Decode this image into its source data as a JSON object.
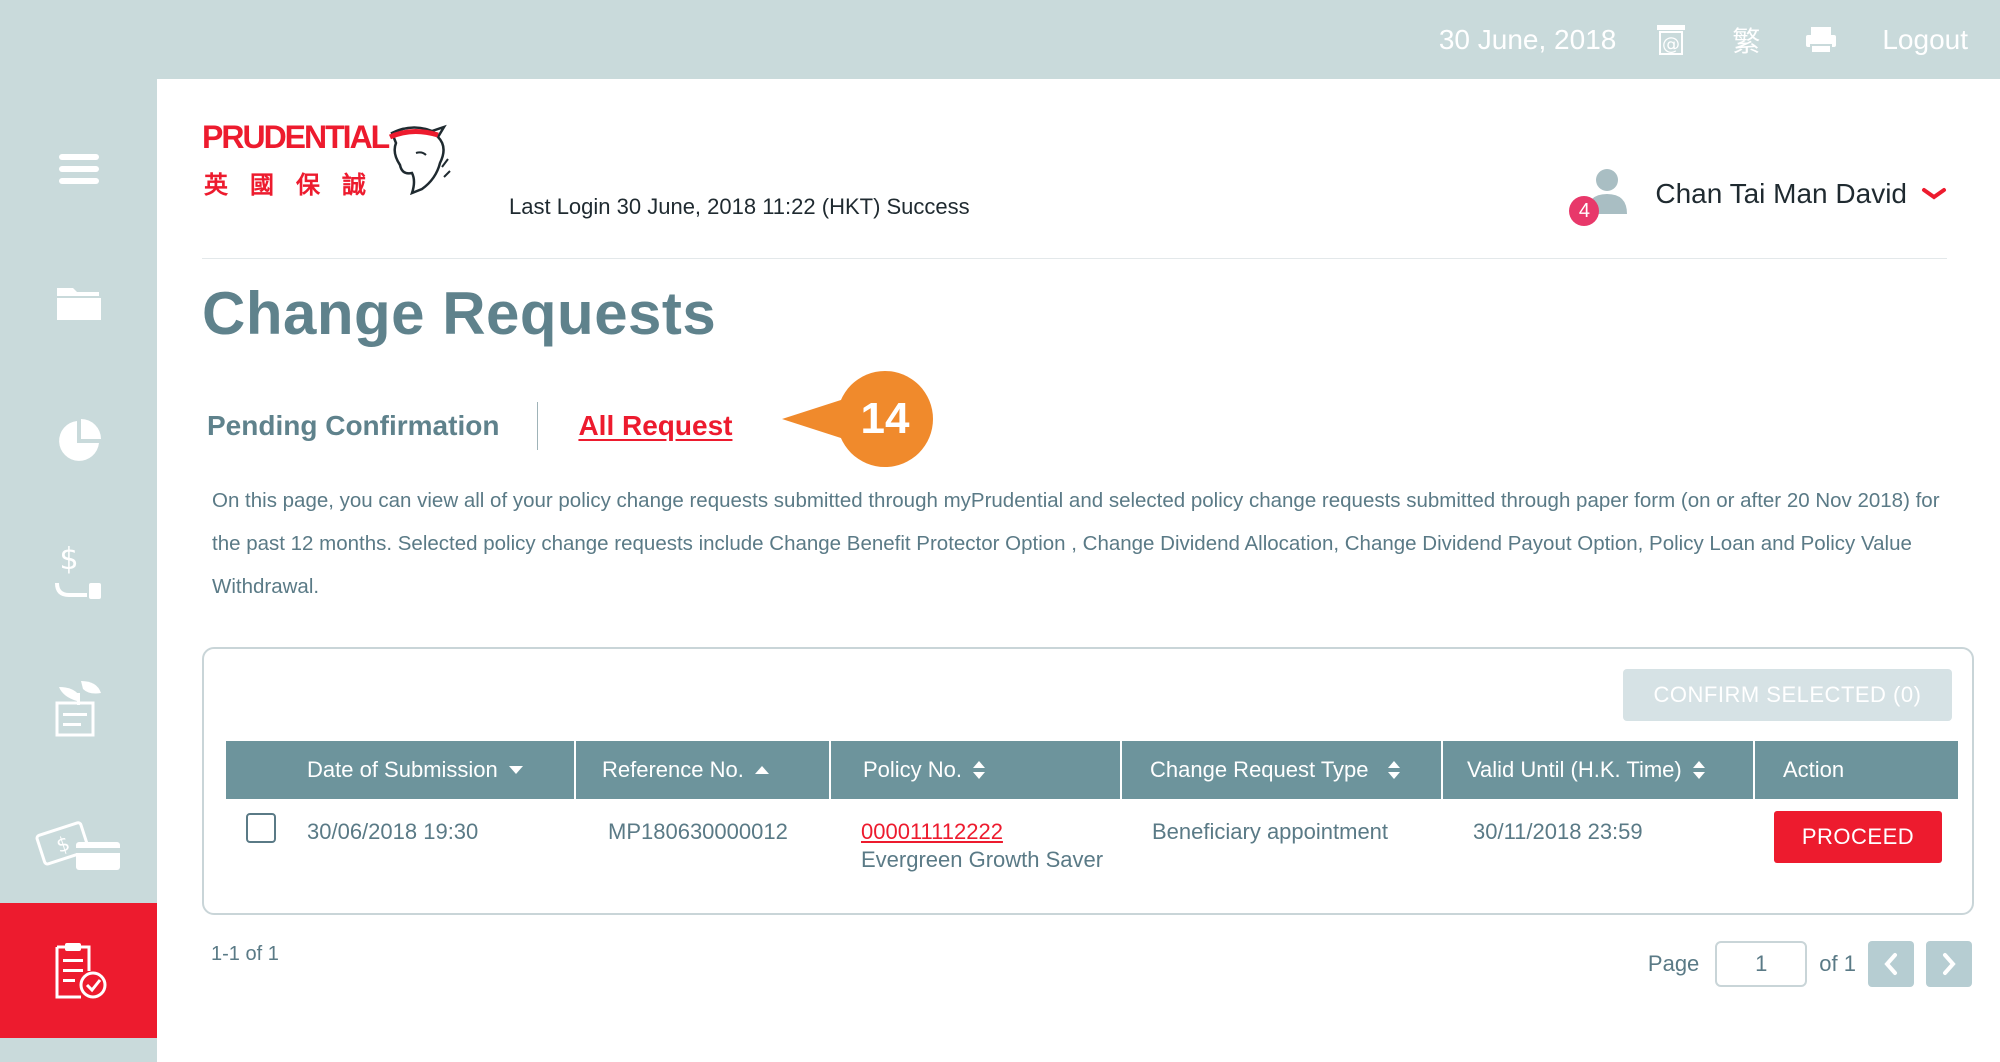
{
  "topbar": {
    "date": "30 June, 2018",
    "icons": [
      "email-icon",
      "language-icon",
      "print-icon"
    ],
    "language_label": "繁",
    "logout_label": "Logout"
  },
  "sidebar": {
    "items": [
      {
        "icon": "menu-icon"
      },
      {
        "icon": "folder-icon"
      },
      {
        "icon": "pie-chart-icon"
      },
      {
        "icon": "money-hand-icon"
      },
      {
        "icon": "document-plant-icon"
      },
      {
        "icon": "cash-card-icon"
      },
      {
        "icon": "checklist-icon",
        "active": true
      }
    ],
    "active_color": "#ed1b2e"
  },
  "header": {
    "logo_text": "PRUDENTIAL",
    "logo_cn": "英國保誠",
    "last_login": "Last Login 30 June, 2018 11:22 (HKT) Success",
    "user_name": "Chan Tai Man David",
    "notification_count": "4"
  },
  "page": {
    "title": "Change Requests",
    "tabs": [
      {
        "label": "Pending Confirmation",
        "active": false
      },
      {
        "label": "All Request",
        "active": true
      }
    ],
    "callout_number": "14",
    "callout_color": "#f08a2c",
    "intro": "On this page, you can view all of your policy change requests submitted through myPrudential and selected policy change requests submitted through paper form (on or after 20 Nov 2018) for the past 12 months. Selected policy change requests include Change Benefit Protector Option , Change Dividend Allocation, Change Dividend Payout Option, Policy Loan and Policy Value Withdrawal."
  },
  "table": {
    "confirm_label": "CONFIRM SELECTED (0)",
    "columns": [
      {
        "label": "Date of Submission",
        "sort": "desc"
      },
      {
        "label": "Reference No.",
        "sort": "asc"
      },
      {
        "label": "Policy No.",
        "sort": "both"
      },
      {
        "label": "Change Request Type",
        "sort": "both"
      },
      {
        "label": "Valid Until (H.K. Time)",
        "sort": "both"
      },
      {
        "label": "Action",
        "sort": "none"
      }
    ],
    "rows": [
      {
        "date": "30/06/2018 19:30",
        "reference": "MP180630000012",
        "policy_no": "000011112222",
        "policy_name": "Evergreen Growth Saver",
        "type": "Beneficiary appointment",
        "valid_until": "30/11/2018 23:59",
        "action": "PROCEED"
      }
    ]
  },
  "pagination": {
    "record_count": "1-1 of 1",
    "page_label": "Page",
    "current_page": "1",
    "of_label": "of 1"
  }
}
